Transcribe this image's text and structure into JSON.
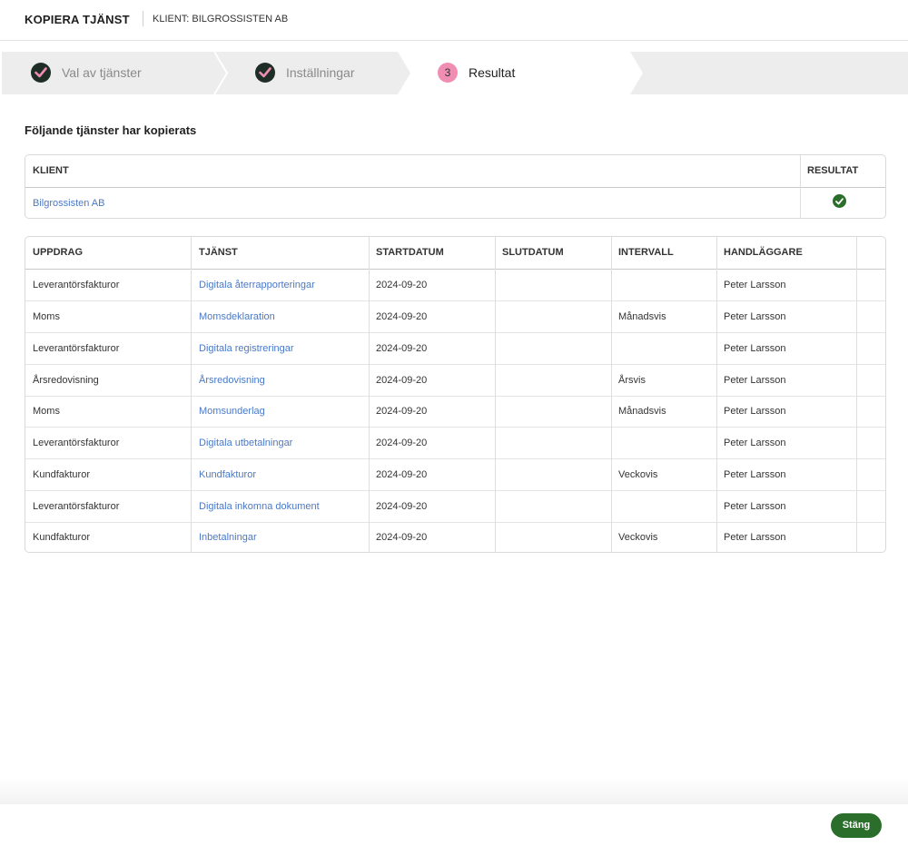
{
  "header": {
    "title": "KOPIERA TJÄNST",
    "client": "KLIENT: BILGROSSISTEN AB"
  },
  "steps": [
    {
      "label": "Val av tjänster",
      "state": "done"
    },
    {
      "label": "Inställningar",
      "state": "done"
    },
    {
      "label": "Resultat",
      "state": "active",
      "number": "3"
    }
  ],
  "section_title": "Följande tjänster har kopierats",
  "client_table": {
    "headers": {
      "client": "KLIENT",
      "result": "RESULTAT"
    },
    "row": {
      "client": "Bilgrossisten AB",
      "result_icon": "check-circle-icon"
    }
  },
  "services_table": {
    "headers": [
      "UPPDRAG",
      "TJÄNST",
      "STARTDATUM",
      "SLUTDATUM",
      "INTERVALL",
      "HANDLÄGGARE"
    ],
    "rows": [
      {
        "uppdrag": "Leverantörsfakturor",
        "tjanst": "Digitala återrapporteringar",
        "start": "2024-09-20",
        "slut": "",
        "intervall": "",
        "handlaggare": "Peter Larsson"
      },
      {
        "uppdrag": "Moms",
        "tjanst": "Momsdeklaration",
        "start": "2024-09-20",
        "slut": "",
        "intervall": "Månadsvis",
        "handlaggare": "Peter Larsson"
      },
      {
        "uppdrag": "Leverantörsfakturor",
        "tjanst": "Digitala registreringar",
        "start": "2024-09-20",
        "slut": "",
        "intervall": "",
        "handlaggare": "Peter Larsson"
      },
      {
        "uppdrag": "Årsredovisning",
        "tjanst": "Årsredovisning",
        "start": "2024-09-20",
        "slut": "",
        "intervall": "Årsvis",
        "handlaggare": "Peter Larsson"
      },
      {
        "uppdrag": "Moms",
        "tjanst": "Momsunderlag",
        "start": "2024-09-20",
        "slut": "",
        "intervall": "Månadsvis",
        "handlaggare": "Peter Larsson"
      },
      {
        "uppdrag": "Leverantörsfakturor",
        "tjanst": "Digitala utbetalningar",
        "start": "2024-09-20",
        "slut": "",
        "intervall": "",
        "handlaggare": "Peter Larsson"
      },
      {
        "uppdrag": "Kundfakturor",
        "tjanst": "Kundfakturor",
        "start": "2024-09-20",
        "slut": "",
        "intervall": "Veckovis",
        "handlaggare": "Peter Larsson"
      },
      {
        "uppdrag": "Leverantörsfakturor",
        "tjanst": "Digitala inkomna dokument",
        "start": "2024-09-20",
        "slut": "",
        "intervall": "",
        "handlaggare": "Peter Larsson"
      },
      {
        "uppdrag": "Kundfakturor",
        "tjanst": "Inbetalningar",
        "start": "2024-09-20",
        "slut": "",
        "intervall": "Veckovis",
        "handlaggare": "Peter Larsson"
      }
    ]
  },
  "footer": {
    "close_label": "Stäng"
  },
  "colors": {
    "accent_green": "#2b6e2b",
    "link_blue": "#4a79c7",
    "step_done": "#1f2d27",
    "step_active": "#ef8db3",
    "check_mark": "#ef8db3"
  }
}
